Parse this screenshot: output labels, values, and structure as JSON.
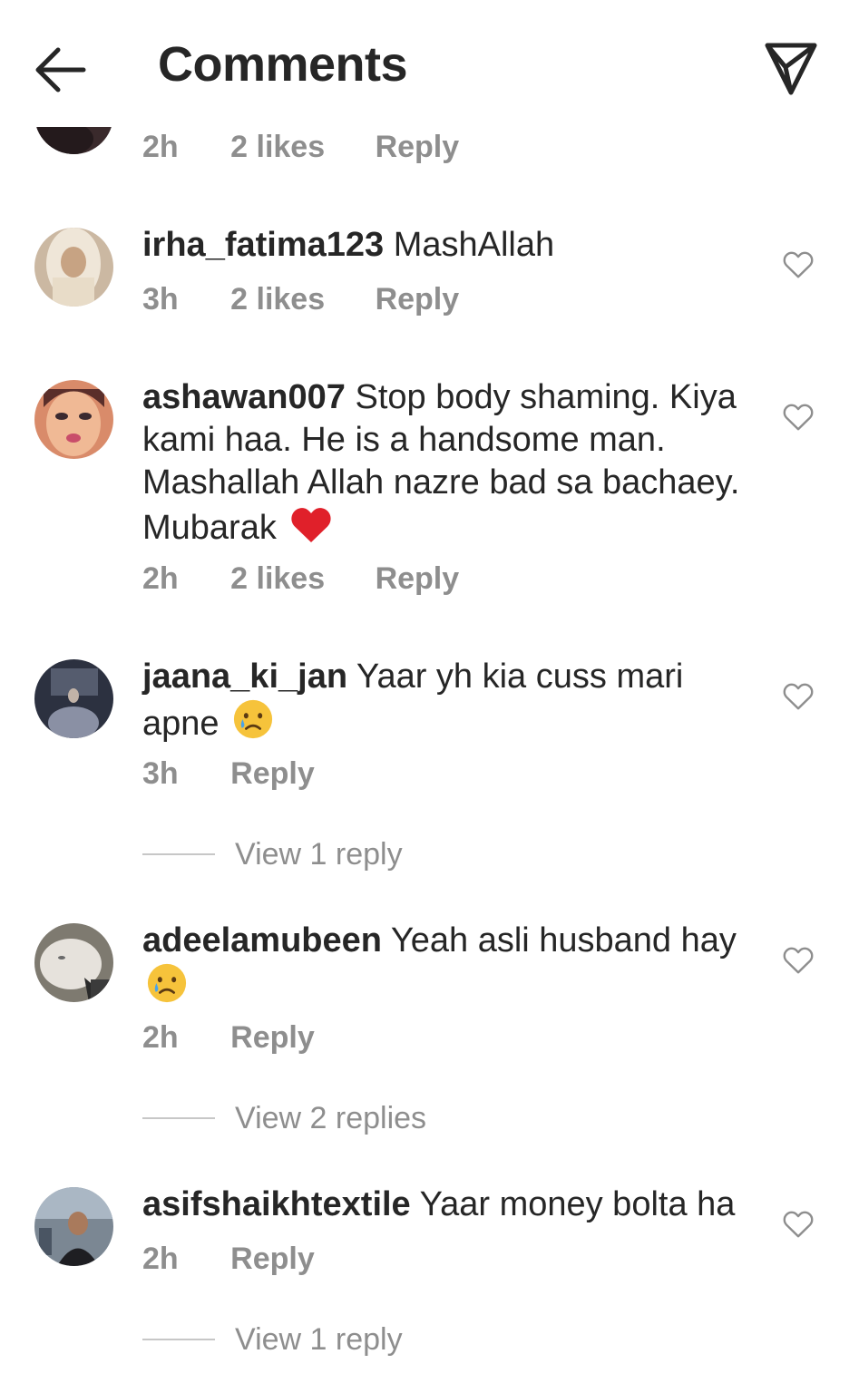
{
  "header": {
    "title": "Comments",
    "back_icon": "arrow-left-icon",
    "send_icon": "paper-plane-icon"
  },
  "comments": [
    {
      "username": "",
      "text": "",
      "time": "2h",
      "likes": "2 likes",
      "reply": "Reply",
      "avatar_color": "#3a2a2c"
    },
    {
      "username": "irha_fatima123",
      "text": "MashAllah",
      "time": "3h",
      "likes": "2 likes",
      "reply": "Reply",
      "avatar_color": "#d9cbb8"
    },
    {
      "username": "ashawan007",
      "text": "Stop body shaming. Kiya kami haa. He is a handsome man. Mashallah Allah nazre bad sa bachaey. Mubarak",
      "emoji": "red-heart-emoji",
      "time": "2h",
      "likes": "2 likes",
      "reply": "Reply",
      "avatar_color": "#e2a07a"
    },
    {
      "username": "jaana_ki_jan",
      "text": "Yaar yh kia cuss mari apne",
      "emoji": "crying-face-emoji",
      "time": "3h",
      "reply": "Reply",
      "view_replies": "View 1 reply",
      "avatar_color": "#3b3f4e"
    },
    {
      "username": "adeelamubeen",
      "text": "Yeah asli husband hay",
      "emoji": "crying-face-emoji",
      "time": "2h",
      "reply": "Reply",
      "view_replies": "View 2 replies",
      "avatar_color": "#9a958c"
    },
    {
      "username": "asifshaikhtextile",
      "text": "Yaar money bolta ha",
      "time": "2h",
      "reply": "Reply",
      "view_replies": "View 1 reply",
      "avatar_color": "#6d7a86"
    }
  ],
  "colors": {
    "text": "#262626",
    "muted": "#8e8e8e",
    "heart_emoji": "#e0202a",
    "crying_emoji": "#f6c33b"
  }
}
